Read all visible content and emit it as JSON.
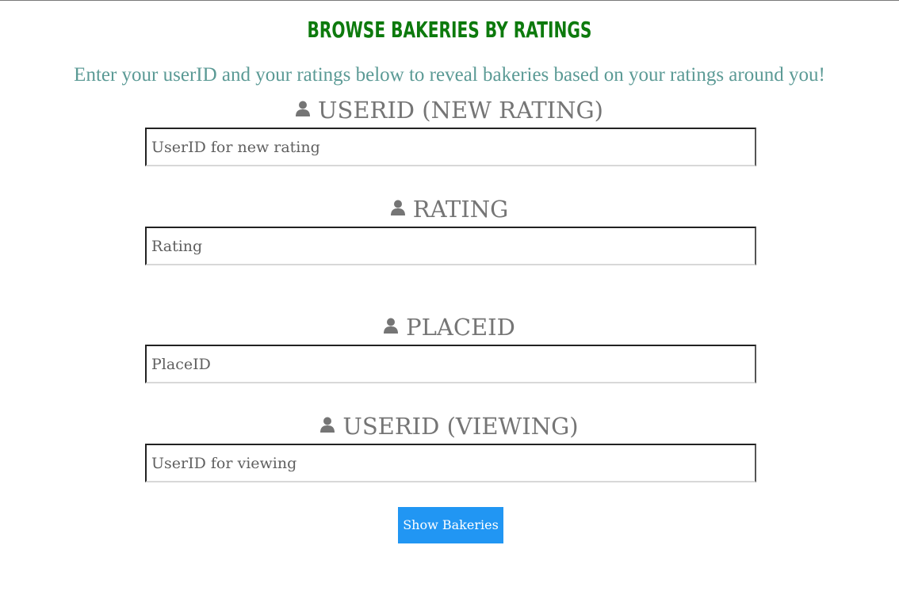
{
  "page": {
    "title": "BROWSE BAKERIES BY RATINGS",
    "subtitle": "Enter your userID and your ratings below to reveal bakeries based on your ratings around you!"
  },
  "colors": {
    "title": "#0d7a0d",
    "subtitle": "#5b9a95",
    "label": "#757575",
    "button_bg": "#2196f3",
    "button_text": "#ffffff"
  },
  "form": {
    "fields": [
      {
        "label": "USERID (NEW RATING)",
        "icon": "user-icon",
        "placeholder": "UserID for new rating",
        "value": ""
      },
      {
        "label": "RATING",
        "icon": "user-icon",
        "placeholder": "Rating",
        "value": ""
      },
      {
        "label": "PLACEID",
        "icon": "user-icon",
        "placeholder": "PlaceID",
        "value": ""
      },
      {
        "label": "USERID (VIEWING)",
        "icon": "user-icon",
        "placeholder": "UserID for viewing",
        "value": ""
      }
    ],
    "submit_label": "Show Bakeries"
  }
}
